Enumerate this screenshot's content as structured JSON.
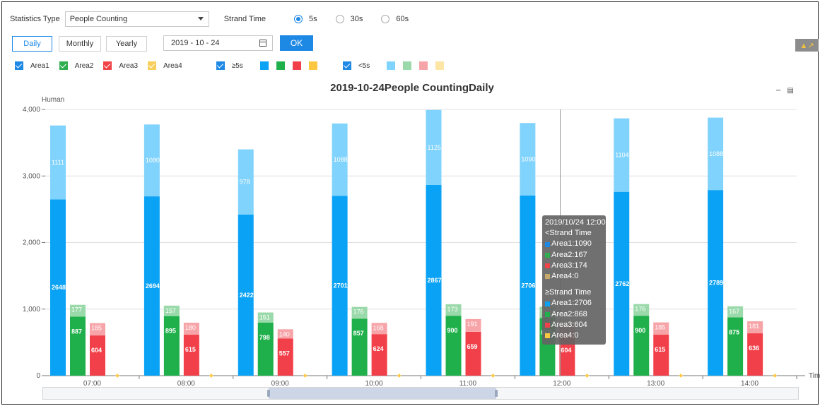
{
  "filters": {
    "statistics_type_label": "Statistics Type",
    "statistics_type_value": "People Counting",
    "strand_time_label": "Strand Time",
    "strand_options": [
      {
        "label": "5s",
        "selected": true
      },
      {
        "label": "30s",
        "selected": false
      },
      {
        "label": "60s",
        "selected": false
      }
    ]
  },
  "period": {
    "tabs": [
      {
        "label": "Daily",
        "active": true
      },
      {
        "label": "Monthly",
        "active": false
      },
      {
        "label": "Yearly",
        "active": false
      }
    ],
    "date_value": "2019 - 10 - 24",
    "ok_label": "OK"
  },
  "legend": {
    "areas": [
      {
        "label": "Area1",
        "color": "#1e88e5"
      },
      {
        "label": "Area2",
        "color": "#2eae4f"
      },
      {
        "label": "Area3",
        "color": "#f04448"
      },
      {
        "label": "Area4",
        "color": "#f7cf5a"
      }
    ],
    "ge_label": "≥5s",
    "lt_label": "<5s",
    "ge_colors": [
      "#0aa2f5",
      "#1fb04b",
      "#f2404a",
      "#fcc842"
    ],
    "lt_colors": [
      "#80d3fc",
      "#9ad9a9",
      "#f7a4a8",
      "#fde5a6"
    ]
  },
  "icons": {
    "export": "export-icon",
    "line_chart": "line-chart-icon",
    "bar_chart": "bar-chart-icon"
  },
  "chart_data": {
    "type": "bar",
    "title": "2019-10-24People CountingDaily",
    "ylabel": "Human",
    "xlabel": "Tim",
    "ylim": [
      0,
      4000
    ],
    "yticks": [
      0,
      1000,
      2000,
      3000,
      4000
    ],
    "ytick_labels": [
      "0",
      "1,000",
      "2,000",
      "3,000",
      "4,000"
    ],
    "categories": [
      "07:00",
      "08:00",
      "09:00",
      "10:00",
      "11:00",
      "12:00",
      "13:00",
      "14:00"
    ],
    "stacked": true,
    "series": [
      {
        "name": "Area1 ≥Strand Time",
        "stack": "Area1",
        "values": [
          2648,
          2694,
          2422,
          2701,
          2867,
          2706,
          2762,
          2789
        ]
      },
      {
        "name": "Area1 <Strand Time",
        "stack": "Area1",
        "values": [
          1111,
          1080,
          978,
          1088,
          1125,
          1090,
          1104,
          1088
        ]
      },
      {
        "name": "Area2 ≥Strand Time",
        "stack": "Area2",
        "values": [
          887,
          895,
          798,
          857,
          900,
          868,
          900,
          875
        ]
      },
      {
        "name": "Area2 <Strand Time",
        "stack": "Area2",
        "values": [
          177,
          157,
          151,
          176,
          173,
          167,
          176,
          167
        ]
      },
      {
        "name": "Area3 ≥Strand Time",
        "stack": "Area3",
        "values": [
          604,
          615,
          557,
          624,
          659,
          604,
          615,
          636
        ]
      },
      {
        "name": "Area3 <Strand Time",
        "stack": "Area3",
        "values": [
          185,
          180,
          140,
          168,
          191,
          174,
          185,
          181
        ]
      },
      {
        "name": "Area4 ≥Strand Time",
        "stack": "Area4",
        "values": [
          0,
          0,
          0,
          0,
          0,
          0,
          0,
          0
        ]
      },
      {
        "name": "Area4 <Strand Time",
        "stack": "Area4",
        "values": [
          0,
          0,
          0,
          0,
          0,
          0,
          0,
          0
        ]
      }
    ],
    "colors": {
      "Area1": [
        "#0aa2f5",
        "#80d3fc"
      ],
      "Area2": [
        "#1fb04b",
        "#9ad9a9"
      ],
      "Area3": [
        "#f2404a",
        "#f7a4a8"
      ],
      "Area4": [
        "#fcc842",
        "#fde5a6"
      ]
    },
    "grid": true,
    "highlighted_category": "12:00"
  },
  "tooltip": {
    "title": "2019/10/24 12:00",
    "lt_header": "<Strand Time",
    "lt_items": [
      "Area1:1090",
      "Area2:167",
      "Area3:174",
      "Area4:0"
    ],
    "ge_header": "≥Strand Time",
    "ge_items": [
      "Area1:2706",
      "Area2:868",
      "Area3:604",
      "Area4:0"
    ],
    "lt_colors": [
      "#1e88e5",
      "#2eae4f",
      "#f04448",
      "#c9a96b"
    ],
    "ge_colors": [
      "#0aa2f5",
      "#1fb04b",
      "#f2404a",
      "#fcc842"
    ]
  }
}
